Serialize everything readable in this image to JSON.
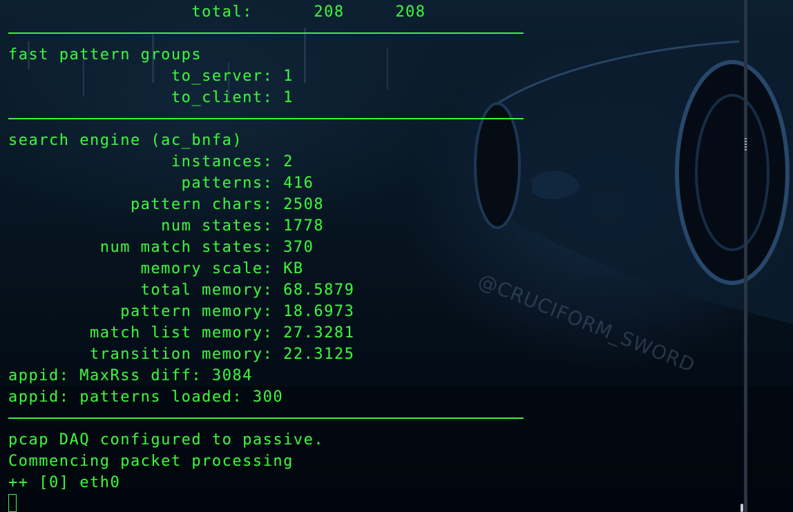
{
  "terminal": {
    "lines": [
      {
        "kind": "text",
        "text": "                  total:      208     208"
      },
      {
        "kind": "rule"
      },
      {
        "kind": "text",
        "text": "fast pattern groups"
      },
      {
        "kind": "text",
        "text": "                to_server: 1"
      },
      {
        "kind": "text",
        "text": "                to_client: 1"
      },
      {
        "kind": "rule"
      },
      {
        "kind": "text",
        "text": "search engine (ac_bnfa)"
      },
      {
        "kind": "text",
        "text": "                instances: 2"
      },
      {
        "kind": "text",
        "text": "                 patterns: 416"
      },
      {
        "kind": "text",
        "text": "            pattern chars: 2508"
      },
      {
        "kind": "text",
        "text": "               num states: 1778"
      },
      {
        "kind": "text",
        "text": "         num match states: 370"
      },
      {
        "kind": "text",
        "text": "             memory scale: KB"
      },
      {
        "kind": "text",
        "text": "             total memory: 68.5879"
      },
      {
        "kind": "text",
        "text": "           pattern memory: 18.6973"
      },
      {
        "kind": "text",
        "text": "        match list memory: 27.3281"
      },
      {
        "kind": "text",
        "text": "        transition memory: 22.3125"
      },
      {
        "kind": "text",
        "text": "appid: MaxRss diff: 3084"
      },
      {
        "kind": "text",
        "text": "appid: patterns loaded: 300"
      },
      {
        "kind": "rule"
      },
      {
        "kind": "text",
        "text": "pcap DAQ configured to passive."
      },
      {
        "kind": "text",
        "text": "Commencing packet processing"
      },
      {
        "kind": "text",
        "text": "++ [0] eth0"
      }
    ]
  },
  "watermark": "@CRUCIFORM_SWORD",
  "colors": {
    "text": "#3ef23e",
    "background": "#03101c"
  }
}
